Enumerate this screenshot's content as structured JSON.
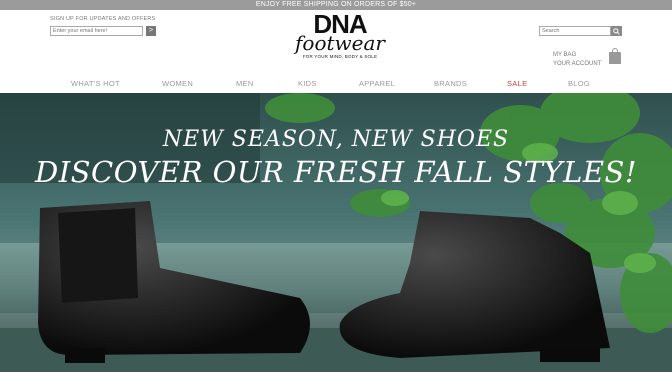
{
  "topbar": {
    "text": "ENJOY FREE SHIPPING ON ORDERS OF $50+"
  },
  "signup": {
    "label": "SIGN UP FOR UPDATES AND OFFERS",
    "placeholder": "Enter your email here!",
    "submit": ">"
  },
  "logo": {
    "line1": "DNA",
    "line2": "footwear",
    "tagline": "FOR YOUR MIND, BODY & SOLE"
  },
  "search": {
    "placeholder": "Search"
  },
  "account": {
    "bag": "MY BAG",
    "account": "YOUR ACCOUNT"
  },
  "nav": [
    {
      "label": "WHAT'S HOT"
    },
    {
      "label": "WOMEN"
    },
    {
      "label": "MEN"
    },
    {
      "label": "KIDS"
    },
    {
      "label": "APPAREL"
    },
    {
      "label": "BRANDS"
    },
    {
      "label": "SALE",
      "color": "#d23b3b"
    },
    {
      "label": "BLOG"
    }
  ],
  "hero": {
    "line1": "NEW SEASON, NEW SHOES",
    "line2": "DISCOVER OUR FRESH FALL STYLES!"
  },
  "colors": {
    "topbar": "#9b9b9b",
    "nav": "#9a9a9a",
    "sale": "#d23b3b",
    "hero_bg": "#3f6b6a"
  }
}
